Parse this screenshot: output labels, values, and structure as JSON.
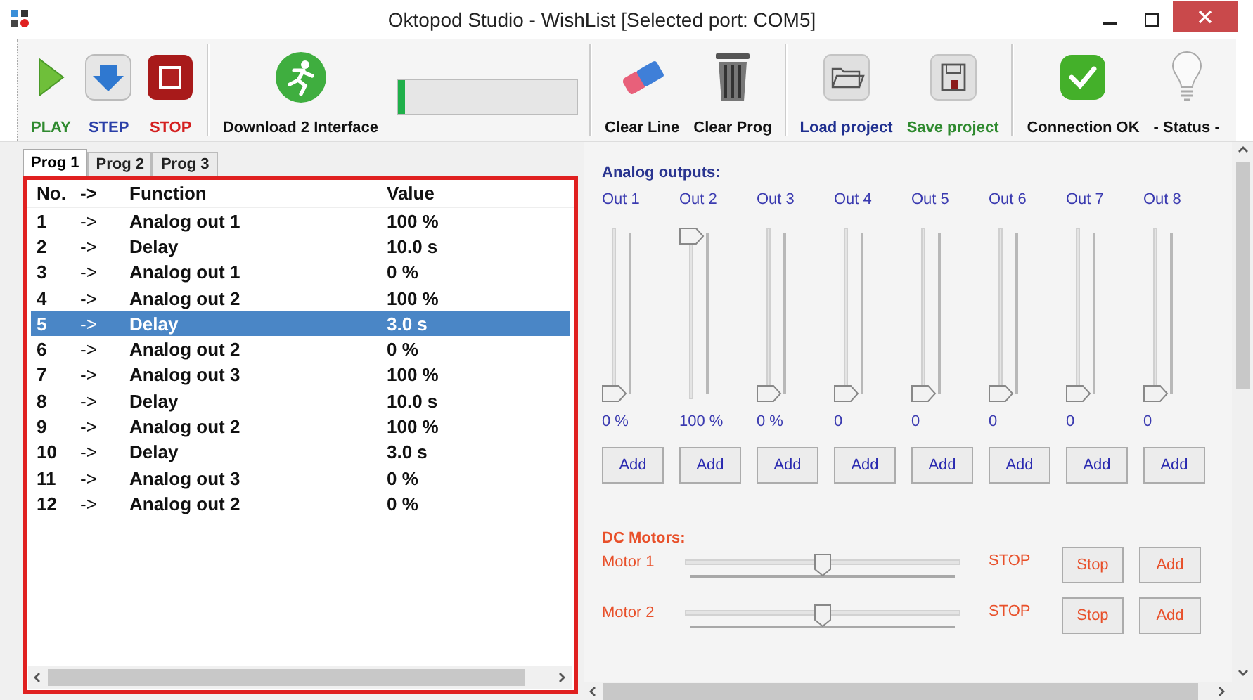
{
  "window": {
    "title": "Oktopod Studio - WishList [Selected port: COM5]"
  },
  "toolbar": {
    "groups": [
      [
        {
          "kind": "play",
          "label": "PLAY",
          "color": "#2f8a2f"
        },
        {
          "kind": "step",
          "label": "STEP",
          "color": "#2a3fa8"
        },
        {
          "kind": "stop",
          "label": "STOP",
          "color": "#d42020"
        }
      ],
      [
        {
          "kind": "download",
          "label": "Download 2 Interface",
          "color": "#111111"
        },
        {
          "kind": "progress",
          "level": 0.04
        }
      ],
      [
        {
          "kind": "clear_line",
          "label": "Clear Line",
          "color": "#111111"
        },
        {
          "kind": "clear_prog",
          "label": "Clear Prog",
          "color": "#111111"
        }
      ],
      [
        {
          "kind": "load",
          "label": "Load project",
          "color": "#1f2f8f"
        },
        {
          "kind": "save",
          "label": "Save project",
          "color": "#2f8a2f"
        }
      ],
      [
        {
          "kind": "connection",
          "label": "Connection OK",
          "color": "#111111"
        },
        {
          "kind": "status",
          "label": "- Status -",
          "color": "#111111"
        }
      ]
    ]
  },
  "tabs": [
    {
      "label": "Prog 1",
      "selected": true
    },
    {
      "label": "Prog 2",
      "selected": false
    },
    {
      "label": "Prog 3",
      "selected": false
    }
  ],
  "program": {
    "columns": [
      "No.",
      "->",
      "Function",
      "Value"
    ],
    "rows": [
      {
        "no": "1",
        "arrow": "->",
        "function": "Analog out 1",
        "value": "100 %",
        "selected": false
      },
      {
        "no": "2",
        "arrow": "->",
        "function": "Delay",
        "value": "10.0 s",
        "selected": false
      },
      {
        "no": "3",
        "arrow": "->",
        "function": "Analog out 1",
        "value": "0 %",
        "selected": false
      },
      {
        "no": "4",
        "arrow": "->",
        "function": "Analog out 2",
        "value": "100 %",
        "selected": false
      },
      {
        "no": "5",
        "arrow": "->",
        "function": "Delay",
        "value": "3.0 s",
        "selected": true
      },
      {
        "no": "6",
        "arrow": "->",
        "function": "Analog out 2",
        "value": "0 %",
        "selected": false
      },
      {
        "no": "7",
        "arrow": "->",
        "function": "Analog out 3",
        "value": "100 %",
        "selected": false
      },
      {
        "no": "8",
        "arrow": "->",
        "function": "Delay",
        "value": "10.0 s",
        "selected": false
      },
      {
        "no": "9",
        "arrow": "->",
        "function": "Analog out 2",
        "value": "100 %",
        "selected": false
      },
      {
        "no": "10",
        "arrow": "->",
        "function": "Delay",
        "value": "3.0 s",
        "selected": false
      },
      {
        "no": "11",
        "arrow": "->",
        "function": "Analog out 3",
        "value": "0 %",
        "selected": false
      },
      {
        "no": "12",
        "arrow": "->",
        "function": "Analog out 2",
        "value": "0 %",
        "selected": false
      }
    ]
  },
  "analog_outputs": {
    "title": "Analog outputs:",
    "channels": [
      {
        "name": "Out 1",
        "level": 0,
        "reading": "0 %",
        "button": "Add"
      },
      {
        "name": "Out 2",
        "level": 1,
        "reading": "100 %",
        "button": "Add"
      },
      {
        "name": "Out 3",
        "level": 0,
        "reading": "0 %",
        "button": "Add"
      },
      {
        "name": "Out 4",
        "level": 0,
        "reading": "0",
        "button": "Add"
      },
      {
        "name": "Out 5",
        "level": 0,
        "reading": "0",
        "button": "Add"
      },
      {
        "name": "Out 6",
        "level": 0,
        "reading": "0",
        "button": "Add"
      },
      {
        "name": "Out 7",
        "level": 0,
        "reading": "0",
        "button": "Add"
      },
      {
        "name": "Out 8",
        "level": 0,
        "reading": "0",
        "button": "Add"
      }
    ]
  },
  "dc_motors": {
    "title": "DC Motors:",
    "motors": [
      {
        "name": "Motor 1",
        "level": 0.5,
        "state": "STOP",
        "buttons": [
          "Stop",
          "Add"
        ]
      },
      {
        "name": "Motor 2",
        "level": 0.5,
        "state": "STOP",
        "buttons": [
          "Stop",
          "Add"
        ]
      }
    ]
  }
}
